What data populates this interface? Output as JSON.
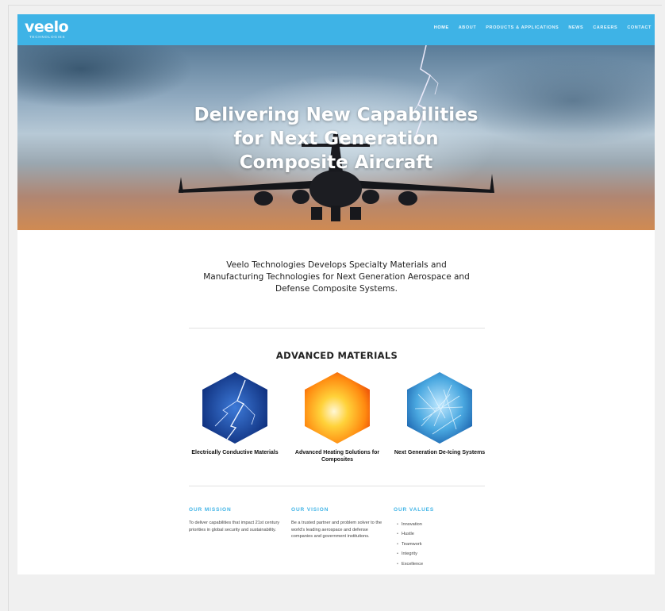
{
  "header": {
    "logo": {
      "word": "veelo",
      "sub": "TECHNOLOGIES"
    },
    "nav": [
      {
        "label": "HOME",
        "active": true
      },
      {
        "label": "ABOUT"
      },
      {
        "label": "PRODUCTS & APPLICATIONS"
      },
      {
        "label": "NEWS"
      },
      {
        "label": "CAREERS"
      },
      {
        "label": "CONTACT"
      }
    ]
  },
  "hero": {
    "title_lines": [
      "Delivering New Capabilities",
      "for Next Generation",
      "Composite Aircraft"
    ]
  },
  "intro": {
    "text": "Veelo Technologies Develops Specialty Materials and Manufacturing Technologies for Next Generation Aerospace and Defense Composite Systems."
  },
  "materials": {
    "title": "ADVANCED MATERIALS",
    "items": [
      {
        "label": "Electrically Conductive Materials"
      },
      {
        "label": "Advanced Heating Solutions for Composites"
      },
      {
        "label": "Next Generation De-Icing Systems"
      }
    ]
  },
  "mission": {
    "title": "OUR MISSION",
    "text": "To deliver capabilities that impact 21st century priorities in global security and sustainability."
  },
  "vision": {
    "title": "OUR VISION",
    "text": "Be a trusted partner and problem solver to the world's leading aerospace and defense companies and government institutions."
  },
  "values": {
    "title": "OUR VALUES",
    "items": [
      "Innovation",
      "Hustle",
      "Teamwork",
      "Integrity",
      "Excellence"
    ]
  },
  "colors": {
    "accent": "#3eb3e6",
    "header_bg": "#3eb3e6"
  }
}
